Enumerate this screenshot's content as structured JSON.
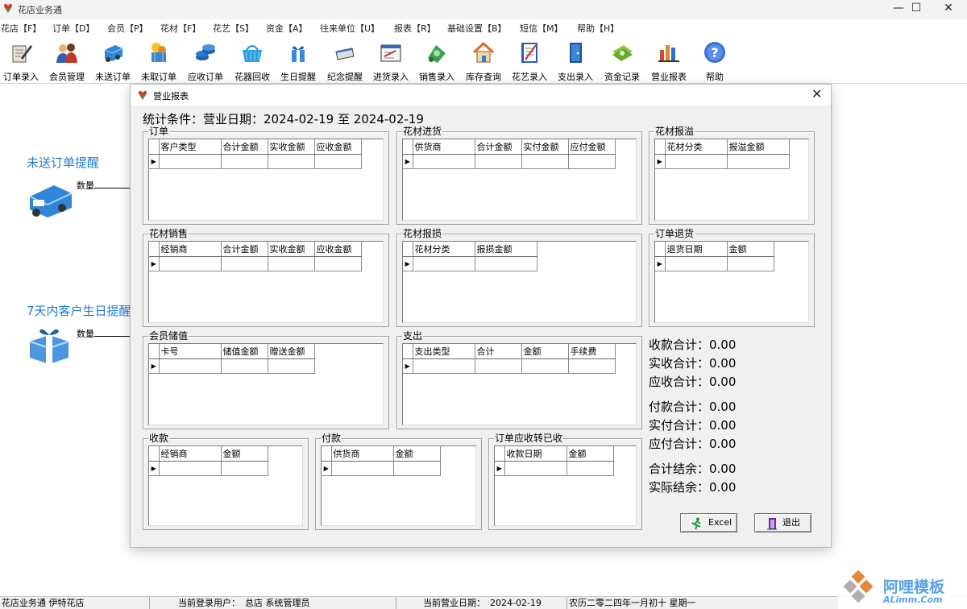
{
  "app": {
    "title": "花店业务通",
    "win_buttons": {
      "minimize": "—",
      "maximize": "☐",
      "close": "✕"
    }
  },
  "menu": [
    "花店【F】",
    "订单【D】",
    "会员【P】",
    "花材【F】",
    "花艺【S】",
    "资金【A】",
    "往来单位【U】",
    "报表【R】",
    "基础设置【B】",
    "短信【M】",
    "帮助【H】"
  ],
  "toolbar": [
    {
      "label": "订单录入",
      "icon": "order-entry-icon"
    },
    {
      "label": "会员管理",
      "icon": "member-icon"
    },
    {
      "label": "未送订单",
      "icon": "truck-icon"
    },
    {
      "label": "未取订单",
      "icon": "pickup-icon"
    },
    {
      "label": "应收订单",
      "icon": "coins-icon"
    },
    {
      "label": "花器回收",
      "icon": "basket-icon"
    },
    {
      "label": "生日提醒",
      "icon": "gift-icon"
    },
    {
      "label": "纪念提醒",
      "icon": "memo-icon"
    },
    {
      "label": "进货录入",
      "icon": "purchase-icon"
    },
    {
      "label": "销售录入",
      "icon": "sales-icon"
    },
    {
      "label": "库存查询",
      "icon": "house-icon"
    },
    {
      "label": "花艺录入",
      "icon": "notebook-icon"
    },
    {
      "label": "支出录入",
      "icon": "door-icon"
    },
    {
      "label": "资金记录",
      "icon": "money-icon"
    },
    {
      "label": "营业报表",
      "icon": "report-icon"
    },
    {
      "label": "帮助",
      "icon": "help-icon"
    }
  ],
  "reminders": {
    "undelivered": {
      "title": "未送订单提醒",
      "qty_label": "数量"
    },
    "birthday": {
      "title": "7天内客户生日提醒",
      "qty_label": "数量"
    }
  },
  "dialog": {
    "title": "营业报表",
    "close": "✕",
    "condition": "统计条件：营业日期：2024-02-19 至 2024-02-19",
    "groups": {
      "order": {
        "label": "订单",
        "columns": [
          "客户类型",
          "合计金额",
          "实收金额",
          "应收金额"
        ]
      },
      "purchase": {
        "label": "花材进货",
        "columns": [
          "供货商",
          "合计金额",
          "实付金额",
          "应付金额"
        ]
      },
      "overflow": {
        "label": "花材报溢",
        "columns": [
          "花材分类",
          "报溢金额"
        ]
      },
      "sales": {
        "label": "花材销售",
        "columns": [
          "经销商",
          "合计金额",
          "实收金额",
          "应收金额"
        ]
      },
      "damage": {
        "label": "花材报损",
        "columns": [
          "花材分类",
          "报损金额"
        ]
      },
      "refund": {
        "label": "订单退货",
        "columns": [
          "退货日期",
          "金额"
        ]
      },
      "deposit": {
        "label": "会员储值",
        "columns": [
          "卡号",
          "储值金额",
          "赠送金额"
        ]
      },
      "expense": {
        "label": "支出",
        "columns": [
          "支出类型",
          "合计",
          "金额",
          "手续费"
        ]
      },
      "receipt": {
        "label": "收款",
        "columns": [
          "经销商",
          "金额"
        ]
      },
      "payment": {
        "label": "付款",
        "columns": [
          "供货商",
          "金额"
        ]
      },
      "converted": {
        "label": "订单应收转已收",
        "columns": [
          "收款日期",
          "金额"
        ]
      }
    },
    "summary": {
      "recv_total": "收款合计：0.00",
      "actual_recv": "实收合计：0.00",
      "due_recv": "应收合计：0.00",
      "pay_total": "付款合计：0.00",
      "actual_pay": "实付合计：0.00",
      "due_pay": "应付合计：0.00",
      "balance": "合计结余：0.00",
      "actual_balance": "实际结余：0.00"
    },
    "buttons": {
      "excel": "Excel",
      "exit": "退出"
    }
  },
  "statusbar": {
    "app": "花店业务通 伊特花店",
    "user_label": "当前登录用户：",
    "user_value": "总店  系统管理员",
    "date_label": "当前营业日期：",
    "date_value": "2024-02-19",
    "lunar": "农历二零二四年一月初十  星期一"
  },
  "watermark": {
    "text": "阿哩模板",
    "sub": "ALimm.Com"
  },
  "colors": {
    "accent": "#1f7bd6",
    "window": "#f0f0f0"
  }
}
